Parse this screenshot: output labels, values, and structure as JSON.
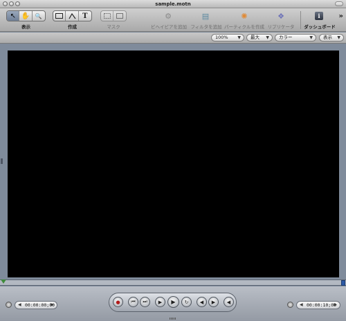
{
  "window": {
    "title": "sample.motn"
  },
  "toolbar": {
    "groups": [
      {
        "label": "表示",
        "icons": [
          "arrow-icon",
          "hand-icon",
          "zoom-icon"
        ]
      },
      {
        "label": "作成",
        "icons": [
          "rectangle-icon",
          "bezier-icon",
          "text-icon"
        ]
      },
      {
        "label": "マスク",
        "icons": [
          "rect-mask-icon",
          "bezier-mask-icon"
        ]
      }
    ],
    "buttons": [
      {
        "label": "ビヘイビアを追加",
        "icon": "gear-icon"
      },
      {
        "label": "フィルタを追加",
        "icon": "filter-icon"
      },
      {
        "label": "パーティクルを作成",
        "icon": "particles-icon"
      },
      {
        "label": "リプリケータ",
        "icon": "replicator-icon"
      }
    ],
    "dashboard_label": "ダッシュボード",
    "overflow": "»"
  },
  "options": {
    "zoom": "100%",
    "quality": "最大",
    "channel": "カラー",
    "view": "表示"
  },
  "transport": {
    "current_time": "00:00:00;00",
    "duration": "00:00:10;00",
    "buttons": [
      "record-icon",
      "go-to-start-icon",
      "go-to-end-icon",
      "play-range-icon",
      "play-icon",
      "loop-icon",
      "previous-frame-icon",
      "next-frame-icon",
      "audio-icon"
    ]
  },
  "glyphs": {
    "arrow": "↖",
    "hand": "✋",
    "zoom": "🔍",
    "text": "T",
    "record": "●",
    "to_start": "⏮",
    "to_end": "⏭",
    "play_range": "▶",
    "play": "▶",
    "loop": "↻",
    "prev": "◀",
    "next": "▶",
    "audio": "◀",
    "gear": "⚙",
    "filter": "▤",
    "particles": "✺",
    "replicator": "❖",
    "info": "i",
    "left": "◀",
    "right": "▶",
    "down": "▼"
  }
}
